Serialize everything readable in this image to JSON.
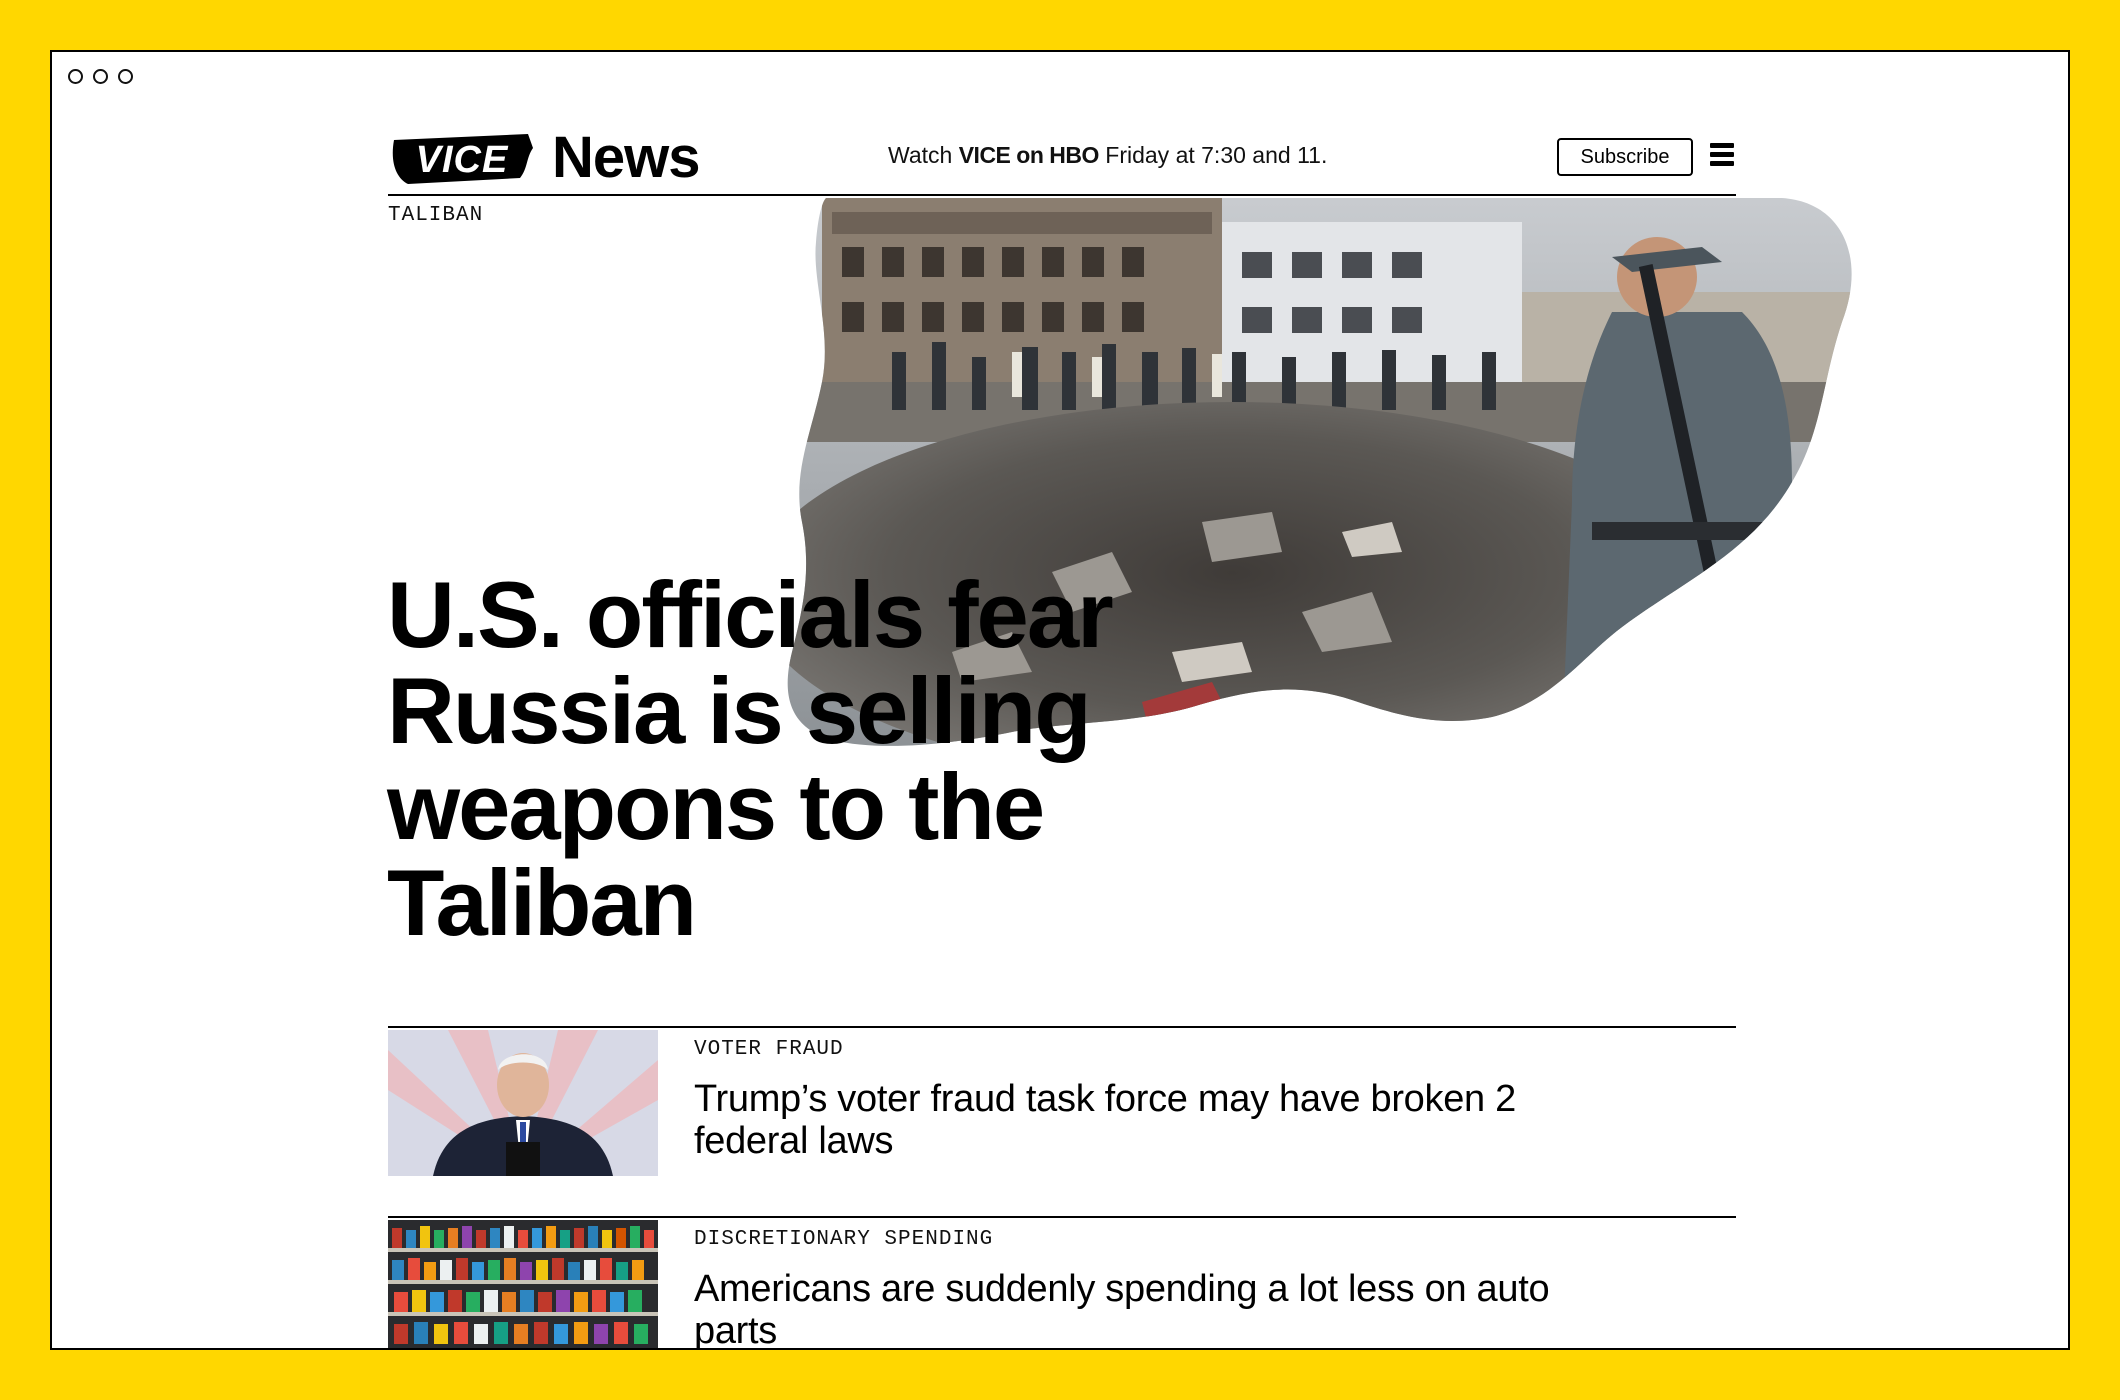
{
  "window": {
    "controls": [
      "dot",
      "dot",
      "dot"
    ]
  },
  "header": {
    "logo_text": "VICE",
    "section_title": "News",
    "promo_prefix": "Watch",
    "promo_bold": "VICE on HBO",
    "promo_suffix": "Friday at 7:30 and 11.",
    "subscribe_label": "Subscribe",
    "menu_icon": "hamburger-menu-icon"
  },
  "hero": {
    "kicker": "TALIBAN",
    "headline": "U.S. officials fear Russia is selling weapons to the Taliban",
    "image_alt": "bomb-crater-scene-photo"
  },
  "stories": [
    {
      "kicker": "VOTER FRAUD",
      "title": "Trump’s voter fraud task force may have broken 2 federal laws",
      "image": "speaker-at-podium-photo"
    },
    {
      "kicker": "DISCRETIONARY SPENDING",
      "title": "Americans are suddenly spending a lot less on auto parts",
      "image": "store-shelves-photo"
    }
  ],
  "colors": {
    "frame": "#FFD700",
    "text": "#000000",
    "background": "#FFFFFF"
  }
}
